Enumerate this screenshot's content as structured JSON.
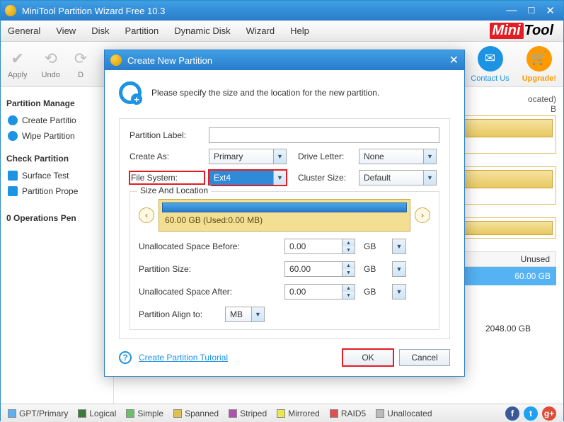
{
  "window": {
    "title": "MiniTool Partition Wizard Free 10.3"
  },
  "menu": {
    "items": [
      "General",
      "View",
      "Disk",
      "Partition",
      "Dynamic Disk",
      "Wizard",
      "Help"
    ]
  },
  "logo": {
    "a": "Mini",
    "b": "Tool"
  },
  "toolbar": {
    "apply": "Apply",
    "undo": "Undo",
    "discard": "D",
    "contact": "Contact Us",
    "upgrade": "Upgrade!"
  },
  "sidebar": {
    "hdr1": "Partition Manage",
    "items1": [
      "Create Partitio",
      "Wipe Partition"
    ],
    "hdr2": "Check Partition",
    "items2": [
      "Surface Test",
      "Partition Prope"
    ],
    "ops": "0 Operations Pen"
  },
  "content": {
    "hint1": "ocated)",
    "hint1b": "B",
    "table": {
      "col_unused": "Unused",
      "rows": [
        {
          "v": "60.00 GB",
          "sel": true
        },
        {
          "v": "2048.00 GB",
          "sel": false
        }
      ]
    }
  },
  "status": {
    "legend": [
      "GPT/Primary",
      "Logical",
      "Simple",
      "Spanned",
      "Striped",
      "Mirrored",
      "RAID5",
      "Unallocated"
    ],
    "colors": [
      "#5bb0ef",
      "#3a7a3a",
      "#6ac06a",
      "#e0c050",
      "#b050b0",
      "#e8e850",
      "#e05050",
      "#bbbbbb"
    ]
  },
  "dialog": {
    "title": "Create New Partition",
    "intro": "Please specify the size and the location for the new partition.",
    "labels": {
      "partition_label": "Partition Label:",
      "create_as": "Create As:",
      "drive_letter": "Drive Letter:",
      "file_system": "File System:",
      "cluster_size": "Cluster Size:"
    },
    "values": {
      "partition_label": "",
      "create_as": "Primary",
      "drive_letter": "None",
      "file_system": "Ext4",
      "cluster_size": "Default"
    },
    "size": {
      "legend": "Size And Location",
      "bar_text": "60.00 GB (Used:0.00 MB)",
      "labels": {
        "before": "Unallocated Space Before:",
        "psize": "Partition Size:",
        "after": "Unallocated Space After:",
        "align": "Partition Align to:"
      },
      "values": {
        "before": "0.00",
        "psize": "60.00",
        "after": "0.00",
        "align": "MB"
      },
      "unit": "GB"
    },
    "tutorial": "Create Partition Tutorial",
    "ok": "OK",
    "cancel": "Cancel"
  }
}
